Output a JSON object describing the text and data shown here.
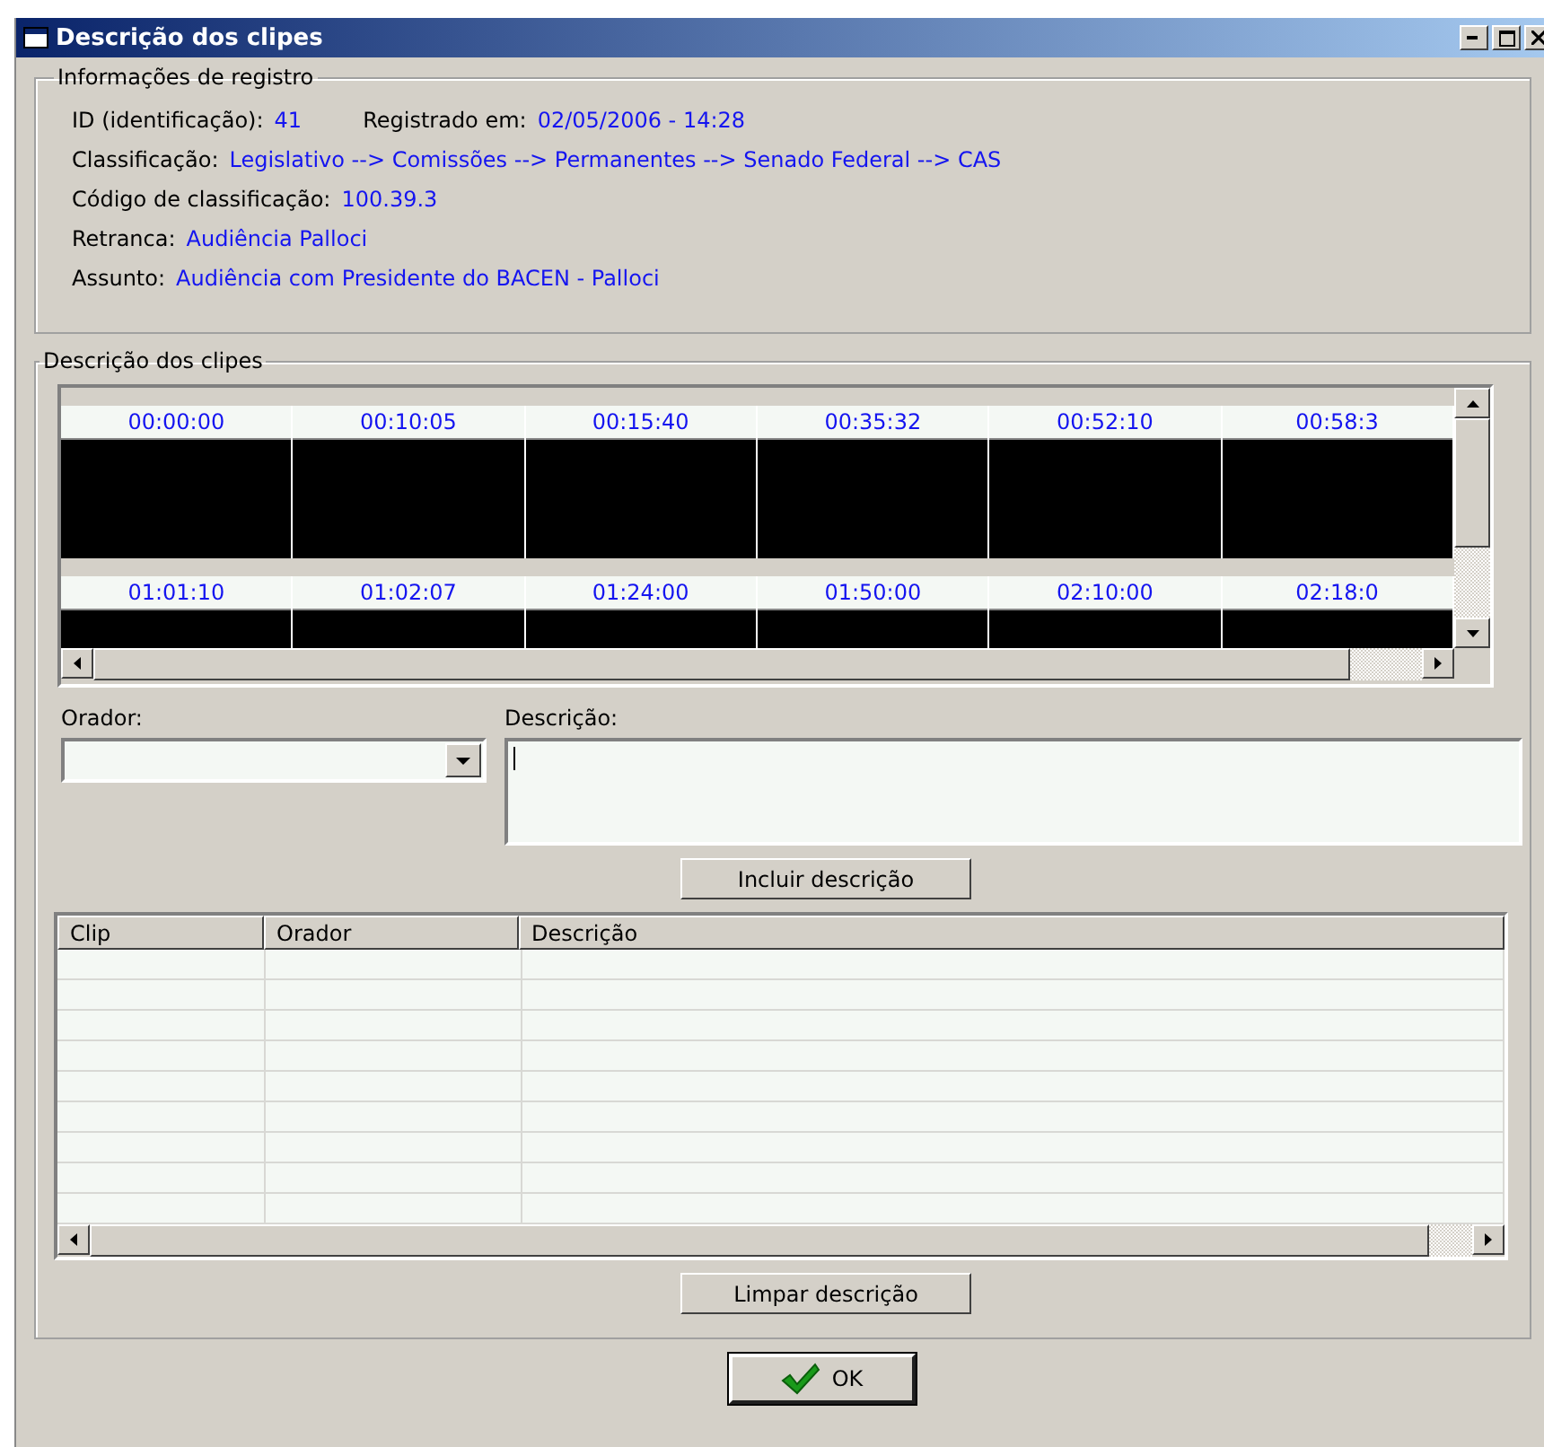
{
  "window": {
    "title": "Descrição dos clipes"
  },
  "registro": {
    "title": "Informações de registro",
    "rows": [
      {
        "fields": [
          {
            "label": "ID (identificação):",
            "value": "41"
          },
          {
            "label": "Registrado em:",
            "value": "02/05/2006 - 14:28"
          }
        ]
      },
      {
        "fields": [
          {
            "label": "Classificação:",
            "value": "Legislativo --> Comissões --> Permanentes --> Senado Federal --> CAS"
          }
        ]
      },
      {
        "fields": [
          {
            "label": "Código de classificação:",
            "value": "100.39.3"
          }
        ]
      },
      {
        "fields": [
          {
            "label": "Retranca:",
            "value": "Audiência Palloci"
          }
        ]
      },
      {
        "fields": [
          {
            "label": "Assunto:",
            "value": "Audiência com Presidente do BACEN - Palloci"
          }
        ]
      }
    ]
  },
  "clipes": {
    "title": "Descrição dos clipes",
    "thumbnail_rows": [
      [
        "00:00:00",
        "00:10:05",
        "00:15:40",
        "00:35:32",
        "00:52:10",
        "00:58:3"
      ],
      [
        "01:01:10",
        "01:02:07",
        "01:24:00",
        "01:50:00",
        "02:10:00",
        "02:18:0"
      ]
    ],
    "orador_label": "Orador:",
    "descricao_label": "Descrição:",
    "incluir_button": "Incluir descrição",
    "table": {
      "columns": [
        "Clip",
        "Orador",
        "Descrição"
      ]
    },
    "limpar_button": "Limpar descrição"
  },
  "ok_button": "OK"
}
